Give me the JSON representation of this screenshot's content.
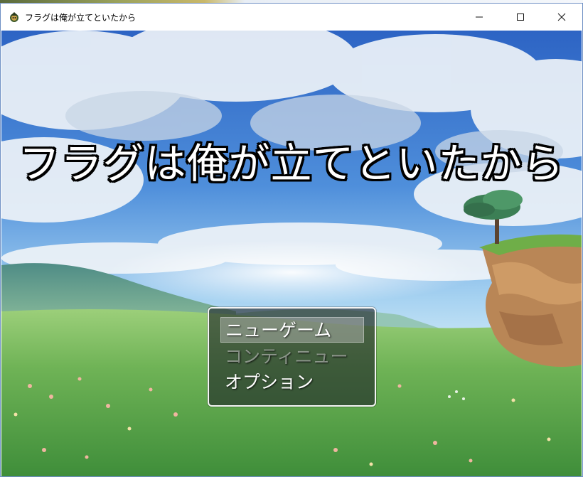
{
  "window": {
    "title": "フラグは俺が立てといたから",
    "controls": [
      "minimize-icon",
      "maximize-icon",
      "close-icon"
    ]
  },
  "game": {
    "title": "フラグは俺が立てといたから"
  },
  "menu": {
    "items": [
      {
        "label": "ニューゲーム",
        "state": "selected"
      },
      {
        "label": "コンティニュー",
        "state": "disabled"
      },
      {
        "label": "オプション",
        "state": "enabled"
      }
    ]
  },
  "colors": {
    "sky_top": "#2f6fc9",
    "sky_light": "#9cc8ee",
    "grass": "#5ea84a",
    "menu_border": "#f4f4f4"
  }
}
